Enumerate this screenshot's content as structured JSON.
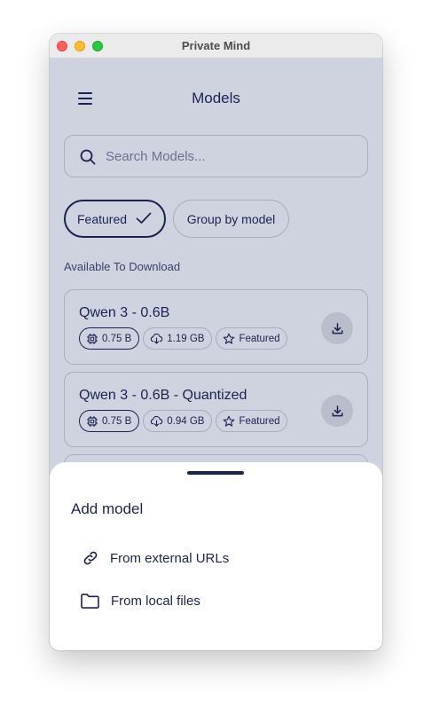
{
  "window": {
    "title": "Private Mind"
  },
  "header": {
    "title": "Models",
    "menu_icon": "hamburger-menu-icon"
  },
  "search": {
    "placeholder": "Search Models...",
    "value": "",
    "icon": "search-icon"
  },
  "filters": {
    "featured_label": "Featured",
    "featured_selected": true,
    "group_label": "Group by model"
  },
  "section": {
    "label": "Available To Download"
  },
  "models": [
    {
      "name": "Qwen 3 - 0.6B",
      "params": "0.75 B",
      "size": "1.19 GB",
      "tag": "Featured"
    },
    {
      "name": "Qwen 3 - 0.6B - Quantized",
      "params": "0.75 B",
      "size": "0.94 GB",
      "tag": "Featured"
    }
  ],
  "sheet": {
    "title": "Add model",
    "options": [
      {
        "label": "From external URLs",
        "icon": "link-icon"
      },
      {
        "label": "From local files",
        "icon": "folder-icon"
      }
    ]
  },
  "colors": {
    "text": "#1b2450",
    "background": "#cfd2df",
    "sheet": "#ffffff",
    "border": "#a7adc2"
  }
}
